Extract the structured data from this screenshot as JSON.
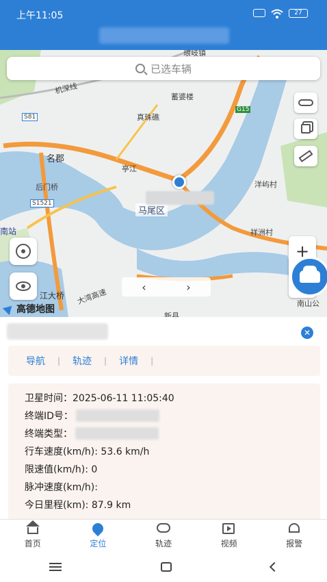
{
  "status_bar": {
    "time": "上午11:05",
    "battery": "27"
  },
  "map": {
    "search_placeholder": "已选车辆",
    "district": "马尾区",
    "labels": [
      "琅岐镇",
      "蓄婆楼",
      "真珠礁",
      "名郡",
      "后门桥",
      "亭江",
      "洋屿村",
      "祥洲村",
      "江大桥",
      "新县",
      "南山公",
      "机深线",
      "S81",
      "G15",
      "S1521",
      "南站",
      "大湾高速"
    ],
    "logo": "高德地图",
    "zoom_in": "+"
  },
  "panel": {
    "actions": [
      "导航",
      "轨迹",
      "详情"
    ],
    "details": {
      "satellite_time": "卫星时间：2025-06-11 11:05:40",
      "terminal_id": "终端ID号：",
      "terminal_type": "终端类型：",
      "speed": "行车速度(km/h): 53.6 km/h",
      "speed_limit": "限速值(km/h): 0",
      "pulse_speed": "脉冲速度(km/h):",
      "today_mileage": "今日里程(km): 87.9 km"
    }
  },
  "bottom_nav": [
    {
      "label": "首页",
      "icon": "home-icon"
    },
    {
      "label": "定位",
      "icon": "location-pin-icon"
    },
    {
      "label": "轨迹",
      "icon": "track-icon"
    },
    {
      "label": "视频",
      "icon": "video-icon"
    },
    {
      "label": "报警",
      "icon": "alarm-icon"
    }
  ],
  "colors": {
    "primary": "#2d7fd6",
    "panel_bg": "#fbf3ef",
    "road": "#f39a3c",
    "water": "#a8cbe6"
  }
}
